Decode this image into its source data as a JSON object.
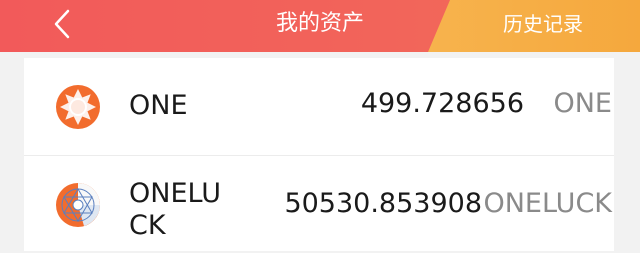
{
  "header": {
    "title": "我的资产",
    "history_label": "历史记录",
    "back_icon": "back-chevron-icon"
  },
  "colors": {
    "header_red": "#f25a5a",
    "header_orange": "#f5a83d",
    "coin_orange": "#f26c2d",
    "unit_gray": "#8a8a8a"
  },
  "assets": [
    {
      "name": "ONE",
      "amount": "499.728656",
      "unit": "ONE",
      "icon": "one-coin-icon"
    },
    {
      "name": "ONELUCK",
      "amount": "50530.853908",
      "unit": "ONELUCK",
      "icon": "oneluck-coin-icon"
    }
  ]
}
